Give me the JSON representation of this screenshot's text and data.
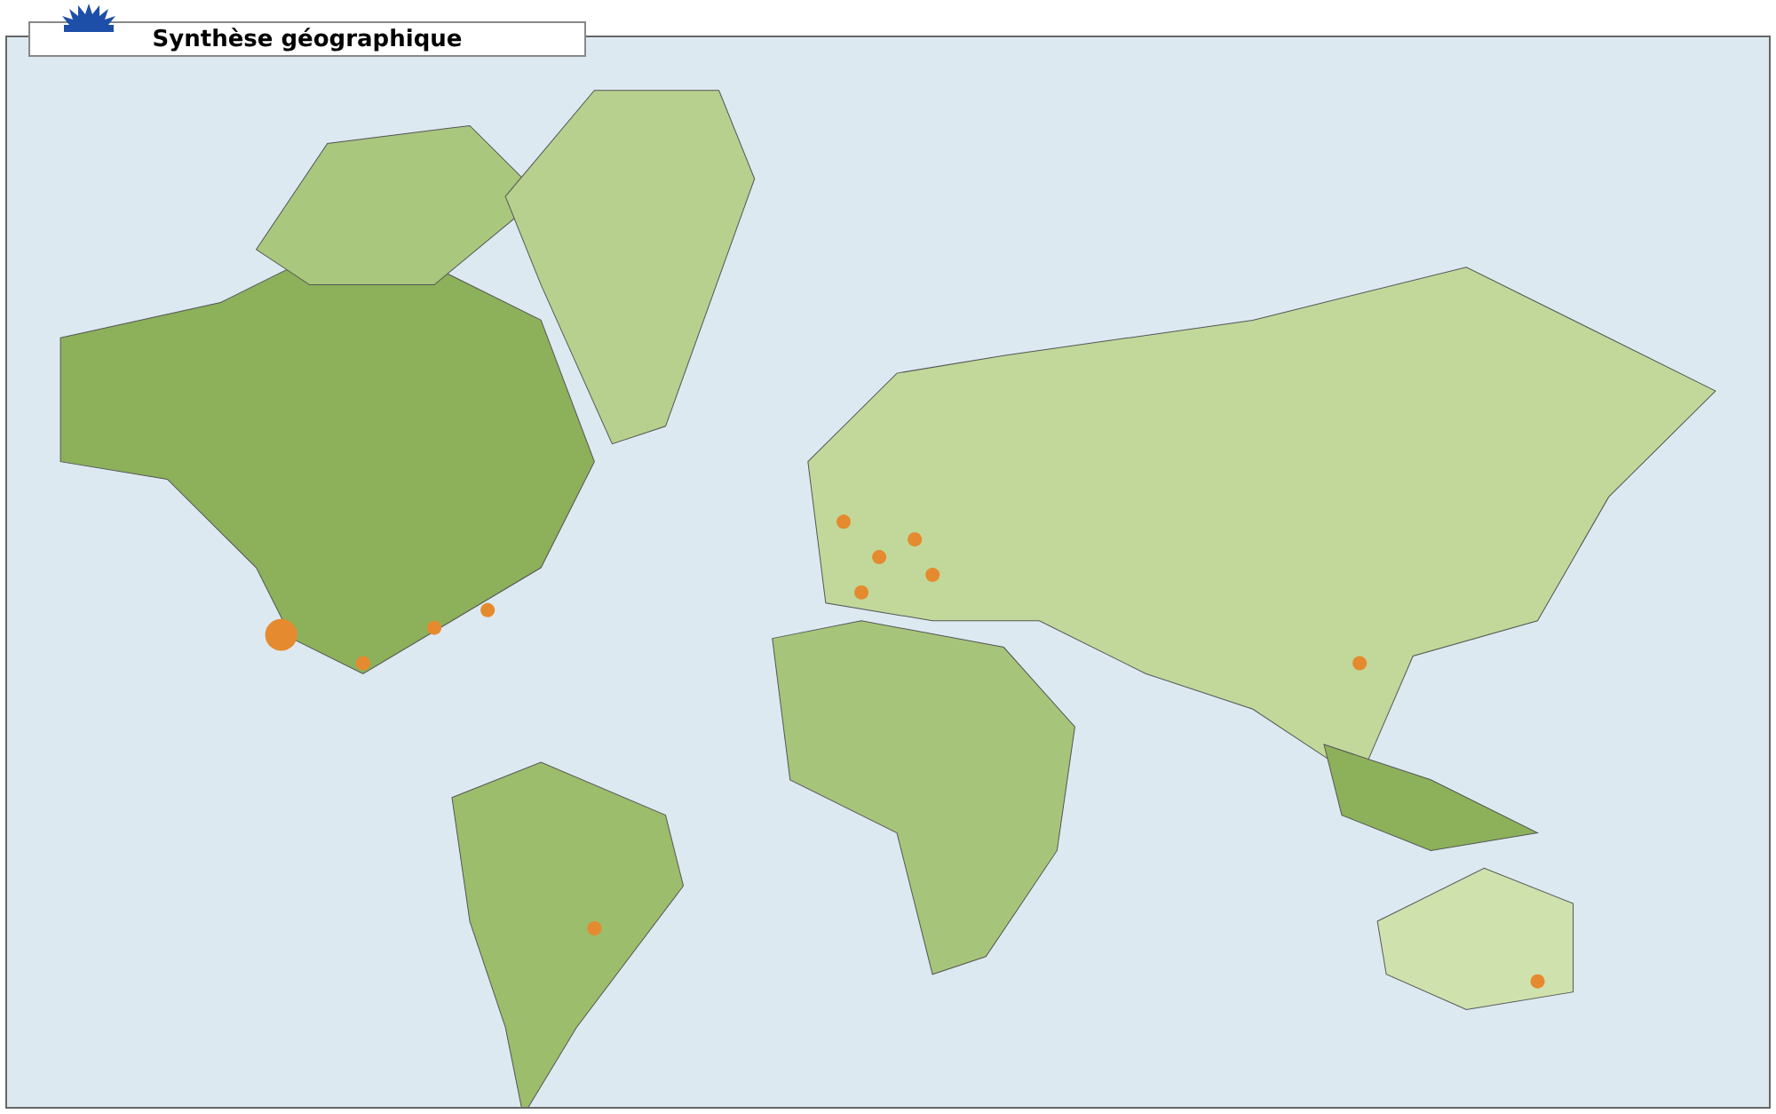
{
  "panel": {
    "title": "Synthèse géographique"
  }
}
